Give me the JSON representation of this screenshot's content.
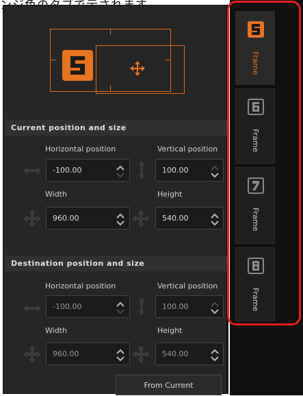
{
  "caption": "ンジ色のタブで示されます。",
  "current": {
    "title": "Current position and size",
    "h_label": "Horizontal position",
    "v_label": "Vertical position",
    "w_label": "Width",
    "hgt_label": "Height",
    "h_value": "-100.00",
    "v_value": "100.00",
    "w_value": "960.00",
    "hgt_value": "540.00"
  },
  "destination": {
    "title": "Destination position and size",
    "h_label": "Horizontal position",
    "v_label": "Vertical position",
    "w_label": "Width",
    "hgt_label": "Height",
    "h_value": "-100.00",
    "v_value": "100.00",
    "w_value": "960.00",
    "hgt_value": "540.00"
  },
  "from_current_label": "From Current",
  "tabs": [
    {
      "number": "5",
      "label": "Frame",
      "active": true
    },
    {
      "number": "6",
      "label": "Frame",
      "active": false
    },
    {
      "number": "7",
      "label": "Frame",
      "active": false
    },
    {
      "number": "8",
      "label": "Frame",
      "active": false
    }
  ],
  "colors": {
    "accent": "#e8731f",
    "highlight": "#e21e1e",
    "panel": "#262626"
  }
}
